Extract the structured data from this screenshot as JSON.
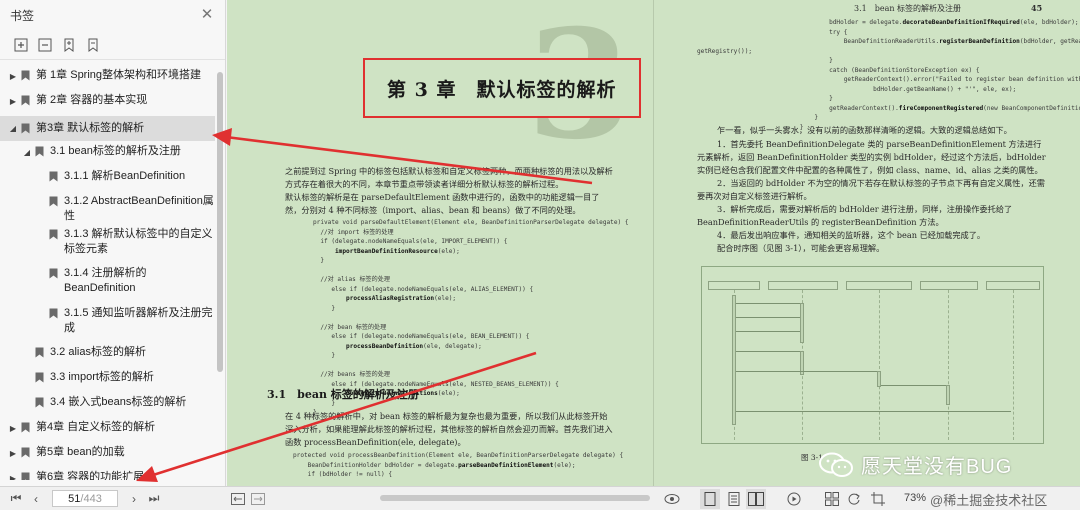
{
  "sidebar": {
    "title": "书签",
    "toc": [
      {
        "label": "第 1章 Spring整体架构和环境搭建",
        "level": 0,
        "expanded": false
      },
      {
        "label": "第 2章 容器的基本实现",
        "level": 0,
        "expanded": false
      },
      {
        "label": "第3章 默认标签的解析",
        "level": 0,
        "expanded": true,
        "active": true
      },
      {
        "label": "3.1 bean标签的解析及注册",
        "level": 1,
        "expanded": true
      },
      {
        "label": "3.1.1 解析BeanDefinition",
        "level": 2
      },
      {
        "label": "3.1.2 AbstractBeanDefinition属性",
        "level": 2
      },
      {
        "label": "3.1.3 解析默认标签中的自定义标签元素",
        "level": 2
      },
      {
        "label": "3.1.4 注册解析的BeanDefinition",
        "level": 2
      },
      {
        "label": "3.1.5 通知监听器解析及注册完成",
        "level": 2
      },
      {
        "label": "3.2 alias标签的解析",
        "level": 1
      },
      {
        "label": "3.3 import标签的解析",
        "level": 1
      },
      {
        "label": "3.4 嵌入式beans标签的解析",
        "level": 1
      },
      {
        "label": "第4章 自定义标签的解析",
        "level": 0,
        "expanded": false
      },
      {
        "label": "第5章 bean的加载",
        "level": 0,
        "expanded": false
      },
      {
        "label": "第6章 容器的功能扩展",
        "level": 0,
        "expanded": false
      }
    ]
  },
  "page_left": {
    "chapter_title": "第 3 章　默认标签的解析",
    "big_number": "3",
    "intro_p1": "之前提到过 Spring 中的标签包括默认标签和自定义标签两种，而两种标签的用法以及解析方式存在着很大的不同，本章节重点带领读者详细分析默认标签的解析过程。",
    "intro_p2": "默认标签的解析是在 parseDefaultElement 函数中进行的，函数中的功能逻辑一目了然，分别对 4 种不同标签（import、alias、bean 和 beans）做了不同的处理。",
    "section_title": "3.1　bean 标签的解析及注册",
    "sec_p": "在 4 种标签的解析中，对 bean 标签的解析最为复杂也最为重要，所以我们从此标签开始深入分析，如果能理解此标签的解析过程，其他标签的解析自然会迎刃而解。首先我们进入函数 processBeanDefinition(ele, delegate)。"
  },
  "page_right": {
    "running_head": "3.1　bean 标签的解析及注册",
    "page_number": "45",
    "p1": "乍一看，似乎一头雾水，没有以前的函数那样清晰的逻辑。大致的逻辑总结如下。",
    "p2": "1．首先委托 BeanDefinitionDelegate 类的 parseBeanDefinitionElement 方法进行元素解析，返回 BeanDefinitionHolder 类型的实例 bdHolder，经过这个方法后，bdHolder 实例已经包含我们配置文件中配置的各种属性了，例如 class、name、id、alias 之类的属性。",
    "p3": "2．当返回的 bdHolder 不为空的情况下若存在默认标签的子节点下再有自定义属性，还需要再次对自定义标签进行解析。",
    "p4": "3．解析完成后，需要对解析后的 bdHolder 进行注册，同样，注册操作委托给了 BeanDefinitionReaderUtils 的 registerBeanDefinition 方法。",
    "p5": "4．最后发出响应事件，通知相关的监听器，这个 bean 已经加载完成了。",
    "p6": "配合时序图（见图 3-1），可能会更容易理解。",
    "diagram_caption": "图 3-1"
  },
  "watermark": {
    "text": "愿天堂没有BUG"
  },
  "statusbar": {
    "current_page": "51",
    "total_pages": "/443",
    "zoom": "73%",
    "footer_text": "@稀土掘金技术社区"
  },
  "colors": {
    "page_bg": "#cfe3c4",
    "annotation_red": "#e03030"
  }
}
